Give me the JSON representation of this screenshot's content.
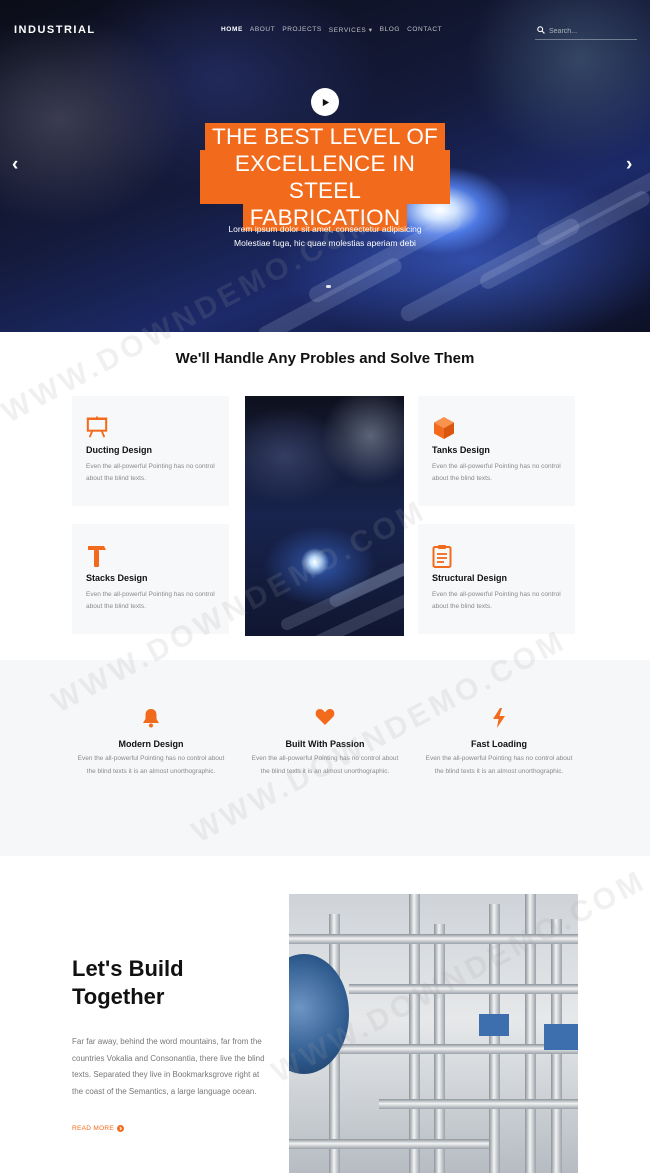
{
  "header": {
    "logo": "INDUSTRIAL",
    "menu": [
      "HOME",
      "ABOUT",
      "PROJECTS",
      "SERVICES ▾",
      "BLOG",
      "CONTACT"
    ],
    "search_placeholder": "Search..."
  },
  "hero": {
    "headline_lines": [
      "THE BEST LEVEL OF",
      "EXCELLENCE IN STEEL",
      "FABRICATION"
    ],
    "text_lines": [
      "Lorem ipsum dolor sit amet, consectetur adipisicing",
      "Molestiae fuga, hic quae molestias aperiam debi"
    ],
    "prev_glyph": "‹",
    "next_glyph": "›",
    "accent_color": "#f26a1b"
  },
  "services": {
    "title": "We'll Handle Any Probles and Solve Them",
    "cards": [
      {
        "icon": "easel-icon",
        "title": "Ducting Design",
        "desc": "Even the all-powerful Pointing has no control about the blind texts."
      },
      {
        "icon": "cube-icon",
        "title": "Tanks Design",
        "desc": "Even the all-powerful Pointing has no control about the blind texts."
      },
      {
        "icon": "hammer-icon",
        "title": "Stacks Design",
        "desc": "Even the all-powerful Pointing has no control about the blind texts."
      },
      {
        "icon": "clipboard-icon",
        "title": "Structural Design",
        "desc": "Even the all-powerful Pointing has no control about the blind texts."
      }
    ]
  },
  "features": [
    {
      "icon": "bell-icon",
      "title": "Modern Design",
      "desc": "Even the all-powerful Pointing has no control about the blind texts it is an almost unorthographic."
    },
    {
      "icon": "heart-icon",
      "title": "Built With Passion",
      "desc": "Even the all-powerful Pointing has no control about the blind texts it is an almost unorthographic."
    },
    {
      "icon": "bolt-icon",
      "title": "Fast Loading",
      "desc": "Even the all-powerful Pointing has no control about the blind texts it is an almost unorthographic."
    }
  ],
  "build": {
    "title_lines": [
      "Let's Build",
      "Together"
    ],
    "text": "Far far away, behind the word mountains, far from the countries Vokalia and Consonantia, there live the blind texts. Separated they live in Bookmarksgrove right at the coast of the Semantics, a large language ocean.",
    "read_more": "READ MORE"
  },
  "watermark": "WWW.DOWNDEMO.COM"
}
